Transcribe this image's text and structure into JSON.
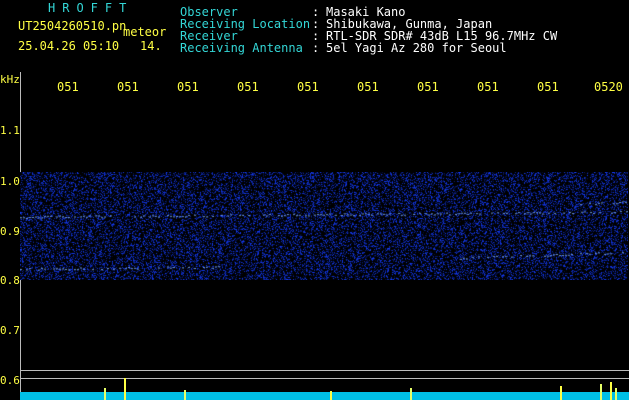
{
  "header": {
    "brand": "HROFFT",
    "filename": "UT2504260510.pn",
    "type_label": "meteor",
    "datetime": "25.04.26 05:10",
    "count": "14.",
    "fields": [
      {
        "label": "Observer",
        "sep": ":",
        "value": "Masaki Kano"
      },
      {
        "label": "Receiving Location",
        "sep": ":",
        "value": "Shibukawa, Gunma, Japan"
      },
      {
        "label": "Receiver",
        "sep": ":",
        "value": "RTL-SDR SDR# 43dB L15 96.7MHz CW"
      },
      {
        "label": "Receiving Antenna",
        "sep": ":",
        "value": "5el Yagi Az 280 for Seoul"
      }
    ]
  },
  "axes": {
    "y_unit": "kHz",
    "y_ticks": [
      "1.1",
      "1.0",
      "0.9",
      "0.8",
      "0.7",
      "0.6"
    ],
    "x_ticks": [
      "051",
      "051",
      "051",
      "051",
      "051",
      "051",
      "051",
      "051",
      "051",
      "0520"
    ]
  },
  "colors": {
    "header_label": "#33d6d6",
    "header_value": "#ffffff",
    "axis": "#ffff44",
    "noise": "#1a3cff",
    "signal": "#7fb4ff",
    "waterline": "#00bfe6"
  }
}
